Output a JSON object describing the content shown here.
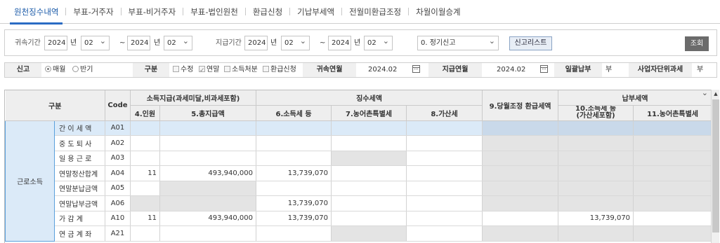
{
  "tabs": [
    "원천징수내역",
    "부표-거주자",
    "부표-비거주자",
    "부표-법인원천",
    "환급신청",
    "기납부세액",
    "전월미환급조정",
    "차월이월승계"
  ],
  "filter": {
    "attribution_label": "귀속기간",
    "from_year": "2024",
    "year_unit": "년",
    "from_month": "02",
    "tilde": "~",
    "to_year": "2024",
    "to_month": "02",
    "payment_label": "지급기간",
    "pay_from_year": "2024",
    "pay_from_month": "02",
    "pay_to_year": "2024",
    "pay_to_month": "02",
    "report_type": "0. 정기신고",
    "report_list_button": "신고리스트",
    "query_button": "조회"
  },
  "infobar": {
    "report_label": "신고",
    "monthly": "매월",
    "half_year": "반기",
    "category_label": "구분",
    "revise": "수정",
    "year_end": "연말",
    "income_disposal": "소득처분",
    "refund_request": "환급신청",
    "attribution_ym_label": "귀속연월",
    "attribution_ym": "2024.02",
    "payment_ym_label": "지급연월",
    "payment_ym": "2024.02",
    "lump_sum_label": "일괄납부",
    "lump_sum_value": "부",
    "business_unit_label": "사업자단위과세",
    "business_unit_value": "부"
  },
  "grid": {
    "headers": {
      "category": "구분",
      "code": "Code",
      "income_payment": "소득지급(과세미달,비과세포함)",
      "withholding": "징수세액",
      "refund_adjust": "9.당월조정 환급세액",
      "payment_tax": "납부세액",
      "people": "4.인원",
      "total_pay": "5.총지급액",
      "income_tax": "6.소득세 등",
      "rural_tax": "7.농어촌특별세",
      "surcharge": "8.가산세",
      "pay_income_tax_1": "10.소득세 등",
      "pay_income_tax_2": "(가산세포함)",
      "pay_rural_tax": "11.농어촌특별세"
    },
    "group_label": "근로소득",
    "rows": [
      {
        "label": "간 이 세 액",
        "code": "A01",
        "people": "",
        "total": "",
        "tax": "",
        "rural": "",
        "surcharge": "",
        "adjust": "",
        "pay_tax": "",
        "pay_rural": ""
      },
      {
        "label": "중 도 퇴 사",
        "code": "A02",
        "people": "",
        "total": "",
        "tax": "",
        "rural": "",
        "surcharge": "",
        "adjust": "",
        "pay_tax": "",
        "pay_rural": ""
      },
      {
        "label": "일 용 근 로",
        "code": "A03",
        "people": "",
        "total": "",
        "tax": "",
        "rural": "",
        "surcharge": "",
        "adjust": "",
        "pay_tax": "",
        "pay_rural": ""
      },
      {
        "label": "연말정산합계",
        "code": "A04",
        "people": "11",
        "total": "493,940,000",
        "tax": "13,739,070",
        "rural": "",
        "surcharge": "",
        "adjust": "",
        "pay_tax": "",
        "pay_rural": ""
      },
      {
        "label": "연말분납금액",
        "code": "A05",
        "people": "",
        "total": "",
        "tax": "",
        "rural": "",
        "surcharge": "",
        "adjust": "",
        "pay_tax": "",
        "pay_rural": ""
      },
      {
        "label": "연말납부금액",
        "code": "A06",
        "people": "",
        "total": "",
        "tax": "13,739,070",
        "rural": "",
        "surcharge": "",
        "adjust": "",
        "pay_tax": "",
        "pay_rural": ""
      },
      {
        "label": "가 감 계",
        "code": "A10",
        "people": "11",
        "total": "493,940,000",
        "tax": "13,739,070",
        "rural": "",
        "surcharge": "",
        "adjust": "",
        "pay_tax": "13,739,070",
        "pay_rural": ""
      },
      {
        "label": "연 금 계 좌",
        "code": "A21",
        "people": "",
        "total": "",
        "tax": "",
        "rural": "",
        "surcharge": "",
        "adjust": "",
        "pay_tax": "",
        "pay_rural": ""
      }
    ]
  }
}
